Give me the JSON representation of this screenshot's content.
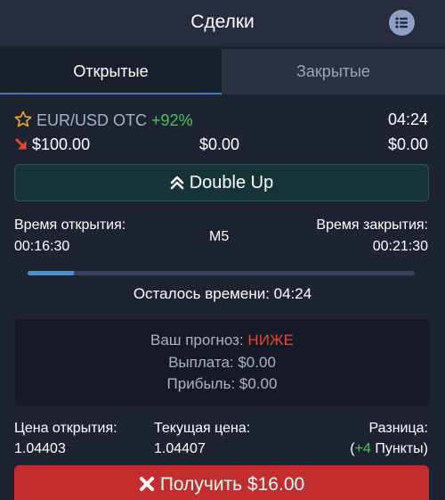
{
  "header": {
    "title": "Сделки",
    "menu_icon": "list-icon"
  },
  "tabs": {
    "open": "Открытые",
    "closed": "Закрытые",
    "active": "open"
  },
  "trade": {
    "asset": "EUR/USD OTC",
    "payout_percent": "+92%",
    "timer": "04:24",
    "amount": "$100.00",
    "middle_value": "$0.00",
    "right_value": "$0.00",
    "direction_icon": "arrow-down-right-icon",
    "favorite_icon": "star-outline-icon"
  },
  "double_up": {
    "label": "Double Up"
  },
  "times": {
    "open_label": "Время открытия:",
    "open_value": "00:16:30",
    "timeframe": "M5",
    "close_label": "Время закрытия:",
    "close_value": "00:21:30"
  },
  "progress": {
    "fraction": 0.12
  },
  "remaining": {
    "text": "Осталось времени: 04:24"
  },
  "forecast": {
    "label": "Ваш прогноз:",
    "value": "НИЖЕ",
    "payout": "Выплата: $0.00",
    "profit": "Прибыль: $0.00"
  },
  "prices": {
    "open_label": "Цена открытия:",
    "open_value": "1.04403",
    "current_label": "Текущая цена:",
    "current_value": "1.04407",
    "diff_label": "Разница:",
    "diff_open": "(",
    "diff_value": "+4",
    "diff_unit": " Пункты)"
  },
  "collect": {
    "label": "Получить $16.00"
  },
  "colors": {
    "background": "#1e2331",
    "header": "#262b3e",
    "accent_blue": "#3e78c8",
    "green": "#4cc25b",
    "red": "#e8472f",
    "collect_button": "#c42d2d",
    "double_up_bg": "#163338"
  }
}
